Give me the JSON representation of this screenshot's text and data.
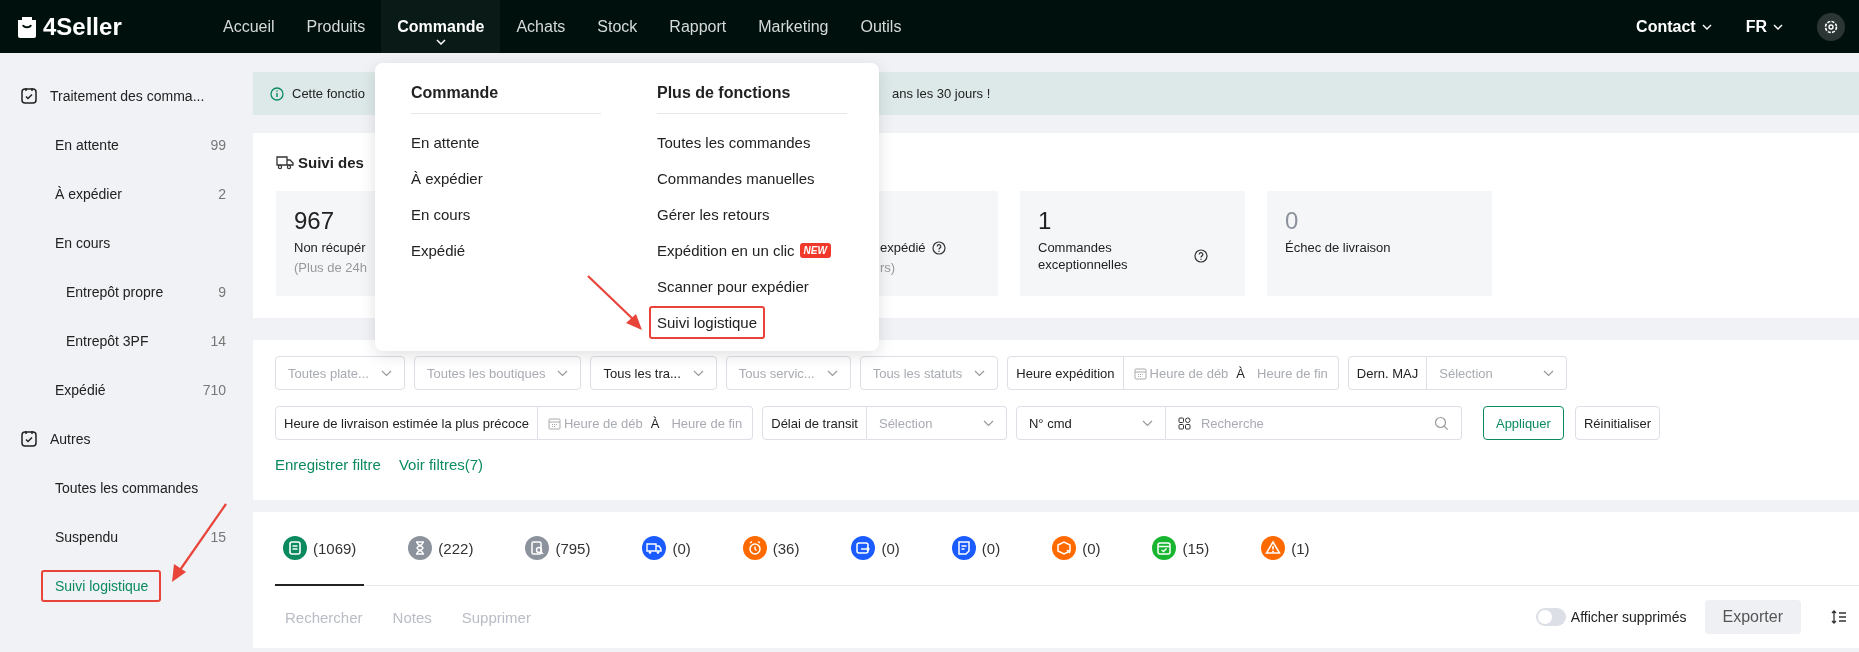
{
  "topbar": {
    "logo": "4Seller",
    "nav": [
      {
        "label": "Accueil",
        "selected": false
      },
      {
        "label": "Produits",
        "selected": false
      },
      {
        "label": "Commande",
        "selected": true
      },
      {
        "label": "Achats",
        "selected": false
      },
      {
        "label": "Stock",
        "selected": false
      },
      {
        "label": "Rapport",
        "selected": false
      },
      {
        "label": "Marketing",
        "selected": false
      },
      {
        "label": "Outils",
        "selected": false
      }
    ],
    "contact": "Contact",
    "language": "FR"
  },
  "nav_menu": {
    "columns": [
      {
        "heading": "Commande",
        "items": [
          {
            "label": "En attente",
            "highlighted": false
          },
          {
            "label": "À expédier",
            "highlighted": false
          },
          {
            "label": "En cours",
            "highlighted": false
          },
          {
            "label": "Expédié",
            "highlighted": false
          }
        ]
      },
      {
        "heading": "Plus de fonctions",
        "items": [
          {
            "label": "Toutes les commandes",
            "highlighted": false
          },
          {
            "label": "Commandes manuelles",
            "highlighted": false
          },
          {
            "label": "Gérer les retours",
            "highlighted": false
          },
          {
            "label": "Expédition en un clic",
            "badge": "NEW",
            "highlighted": false
          },
          {
            "label": "Scanner pour expédier",
            "highlighted": false
          },
          {
            "label": "Suivi logistique",
            "highlighted": true
          }
        ]
      }
    ]
  },
  "sidebar": {
    "sections": [
      {
        "label": "Traitement des comma...",
        "items": [
          {
            "label": "En attente",
            "count": "99",
            "selected": false,
            "highlighted": false
          },
          {
            "label": "À expédier",
            "count": "2",
            "selected": false,
            "highlighted": false
          },
          {
            "label": "En cours",
            "selected": false,
            "highlighted": false,
            "children": [
              {
                "label": "Entrepôt propre",
                "count": "9",
                "selected": false,
                "highlighted": false
              },
              {
                "label": "Entrepôt 3PF",
                "count": "14",
                "selected": false,
                "highlighted": false
              }
            ]
          },
          {
            "label": "Expédié",
            "count": "710",
            "selected": false,
            "highlighted": false
          }
        ]
      },
      {
        "label": "Autres",
        "items": [
          {
            "label": "Toutes les commandes",
            "selected": false,
            "highlighted": false
          },
          {
            "label": "Suspendu",
            "count": "15",
            "selected": false,
            "highlighted": false
          },
          {
            "label": "Suivi logistique",
            "selected": true,
            "highlighted": true
          }
        ]
      }
    ]
  },
  "banner": {
    "text_start": "Cette fonctio",
    "text_end": "ans les 30 jours !"
  },
  "tracking": {
    "title": "Suivi des",
    "cards": [
      {
        "value": "967",
        "label": "Non récupér",
        "note": "(Plus de 24h",
        "help": false,
        "muted": false,
        "covered": false
      },
      {
        "label": "expédié",
        "note": "rs)",
        "help": true,
        "covered": true
      },
      {
        "value": "1",
        "label": "Commandes exceptionnelles",
        "help": true,
        "muted": false,
        "covered": false
      },
      {
        "value": "0",
        "label": "Échec de livraison",
        "help": false,
        "muted": true,
        "covered": false
      }
    ]
  },
  "filters": {
    "first_row": [
      {
        "kind": "select",
        "placeholder": "Toutes plate..."
      },
      {
        "kind": "select",
        "placeholder": "Toutes les boutiques"
      },
      {
        "kind": "select",
        "value": "Tous les tra..."
      },
      {
        "kind": "select",
        "placeholder": "Tous servic..."
      },
      {
        "kind": "select",
        "placeholder": "Tous les statuts"
      },
      {
        "kind": "daterange",
        "label": "Heure expédition",
        "start_placeholder": "Heure de déb",
        "separator": "À",
        "end_placeholder": "Heure de fin"
      },
      {
        "kind": "labeled_select",
        "label": "Dern. MAJ",
        "placeholder": "Sélection"
      }
    ],
    "second_row": [
      {
        "kind": "daterange",
        "label": "Heure de livraison estimée la plus précoce",
        "start_placeholder": "Heure de déb",
        "separator": "À",
        "end_placeholder": "Heure de fin"
      },
      {
        "kind": "labeled_select",
        "label": "Délai de transit",
        "placeholder": "Sélection"
      },
      {
        "kind": "search",
        "field": "N° cmd",
        "placeholder": "Recherche"
      },
      {
        "kind": "button",
        "label": "Appliquer",
        "primary": true
      },
      {
        "kind": "button",
        "label": "Réinitialiser",
        "primary": false
      }
    ],
    "links": [
      "Enregistrer filtre",
      "Voir filtres(7)"
    ]
  },
  "status_tabs": [
    {
      "count": "(1069)",
      "color": "#0b8a60",
      "selected": true
    },
    {
      "count": "(222)",
      "color": "#8c939d",
      "selected": false
    },
    {
      "count": "(795)",
      "color": "#8c939d",
      "selected": false
    },
    {
      "count": "(0)",
      "color": "#1a5cff",
      "selected": false
    },
    {
      "count": "(36)",
      "color": "#ff6a00",
      "selected": false
    },
    {
      "count": "(0)",
      "color": "#1a5cff",
      "selected": false
    },
    {
      "count": "(0)",
      "color": "#1a5cff",
      "selected": false
    },
    {
      "count": "(0)",
      "color": "#ff6a00",
      "selected": false
    },
    {
      "count": "(15)",
      "color": "#17b530",
      "selected": false
    },
    {
      "count": "(1)",
      "color": "#ff6a00",
      "selected": false
    }
  ],
  "actions": [
    {
      "label": "Rechercher",
      "disabled": true
    },
    {
      "label": "Notes",
      "disabled": true
    },
    {
      "label": "Supprimer",
      "disabled": true
    }
  ],
  "show_deleted": {
    "label": "Afficher supprimés",
    "on": false
  },
  "export": "Exporter"
}
